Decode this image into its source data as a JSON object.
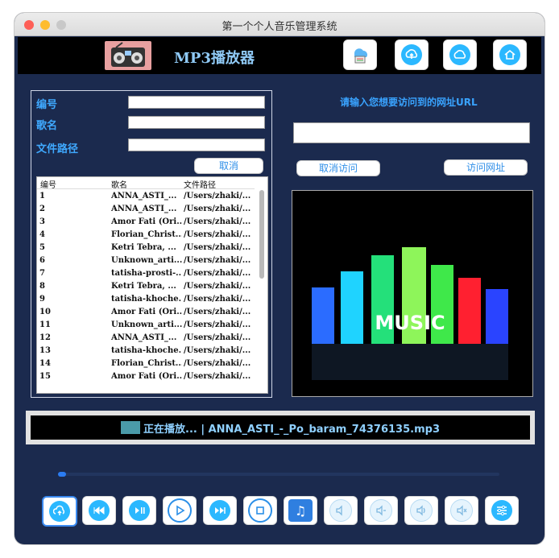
{
  "window": {
    "title": "第一个个人音乐管理系统"
  },
  "header": {
    "app_title": "MP3播放器"
  },
  "form": {
    "id_label": "编号",
    "name_label": "歌名",
    "path_label": "文件路径",
    "id_value": "",
    "name_value": "",
    "path_value": "",
    "cancel_label": "取消"
  },
  "table": {
    "columns": [
      "编号",
      "歌名",
      "文件路径"
    ],
    "rows": [
      [
        "1",
        "ANNA_ASTI_...",
        "/Users/zhaki/..."
      ],
      [
        "2",
        "ANNA_ASTI_...",
        "/Users/zhaki/..."
      ],
      [
        "3",
        "Amor Fati (Ori...",
        "/Users/zhaki/..."
      ],
      [
        "4",
        "Florian_Christ...",
        "/Users/zhaki/..."
      ],
      [
        "5",
        "Ketri  Tebra, ...",
        "/Users/zhaki/..."
      ],
      [
        "6",
        "Unknown_arti...",
        "/Users/zhaki/..."
      ],
      [
        "7",
        "tatisha-prosti-...",
        "/Users/zhaki/..."
      ],
      [
        "8",
        "Ketri  Tebra, ...",
        "/Users/zhaki/..."
      ],
      [
        "9",
        "tatisha-khoche...",
        "/Users/zhaki/..."
      ],
      [
        "10",
        "Amor Fati (Ori...",
        "/Users/zhaki/..."
      ],
      [
        "11",
        "Unknown_arti...",
        "/Users/zhaki/..."
      ],
      [
        "12",
        "ANNA_ASTI_...",
        "/Users/zhaki/..."
      ],
      [
        "13",
        "tatisha-khoche...",
        "/Users/zhaki/..."
      ],
      [
        "14",
        "Florian_Christ...",
        "/Users/zhaki/..."
      ],
      [
        "15",
        "Amor Fati (Ori...",
        "/Users/zhaki/..."
      ]
    ]
  },
  "url": {
    "prompt": "请输入您想要访问到的网址URL",
    "value": "",
    "cancel_label": "取消访问",
    "visit_label": "访问网址"
  },
  "image": {
    "caption": "MUSIC"
  },
  "status": {
    "now_playing": "正在播放... | ANNA_ASTI_-_Po_baram_74376135.mp3"
  },
  "player": {
    "progress": 0.0
  },
  "colors": {
    "window_bg": "#1b2a4e",
    "accent": "#3fa9ff",
    "button_blue": "#2bb8ff"
  },
  "icons": {
    "header": [
      "cloud-device-icon",
      "cloud-upload-icon",
      "cloud-icon",
      "home-icon"
    ],
    "controls": [
      "upload-icon",
      "rewind-icon",
      "play-pause-icon",
      "play-icon",
      "fast-forward-icon",
      "stop-icon",
      "music-note-icon",
      "volume-icon",
      "volume-down-icon",
      "volume-up-icon",
      "mute-icon",
      "equalizer-icon"
    ]
  }
}
